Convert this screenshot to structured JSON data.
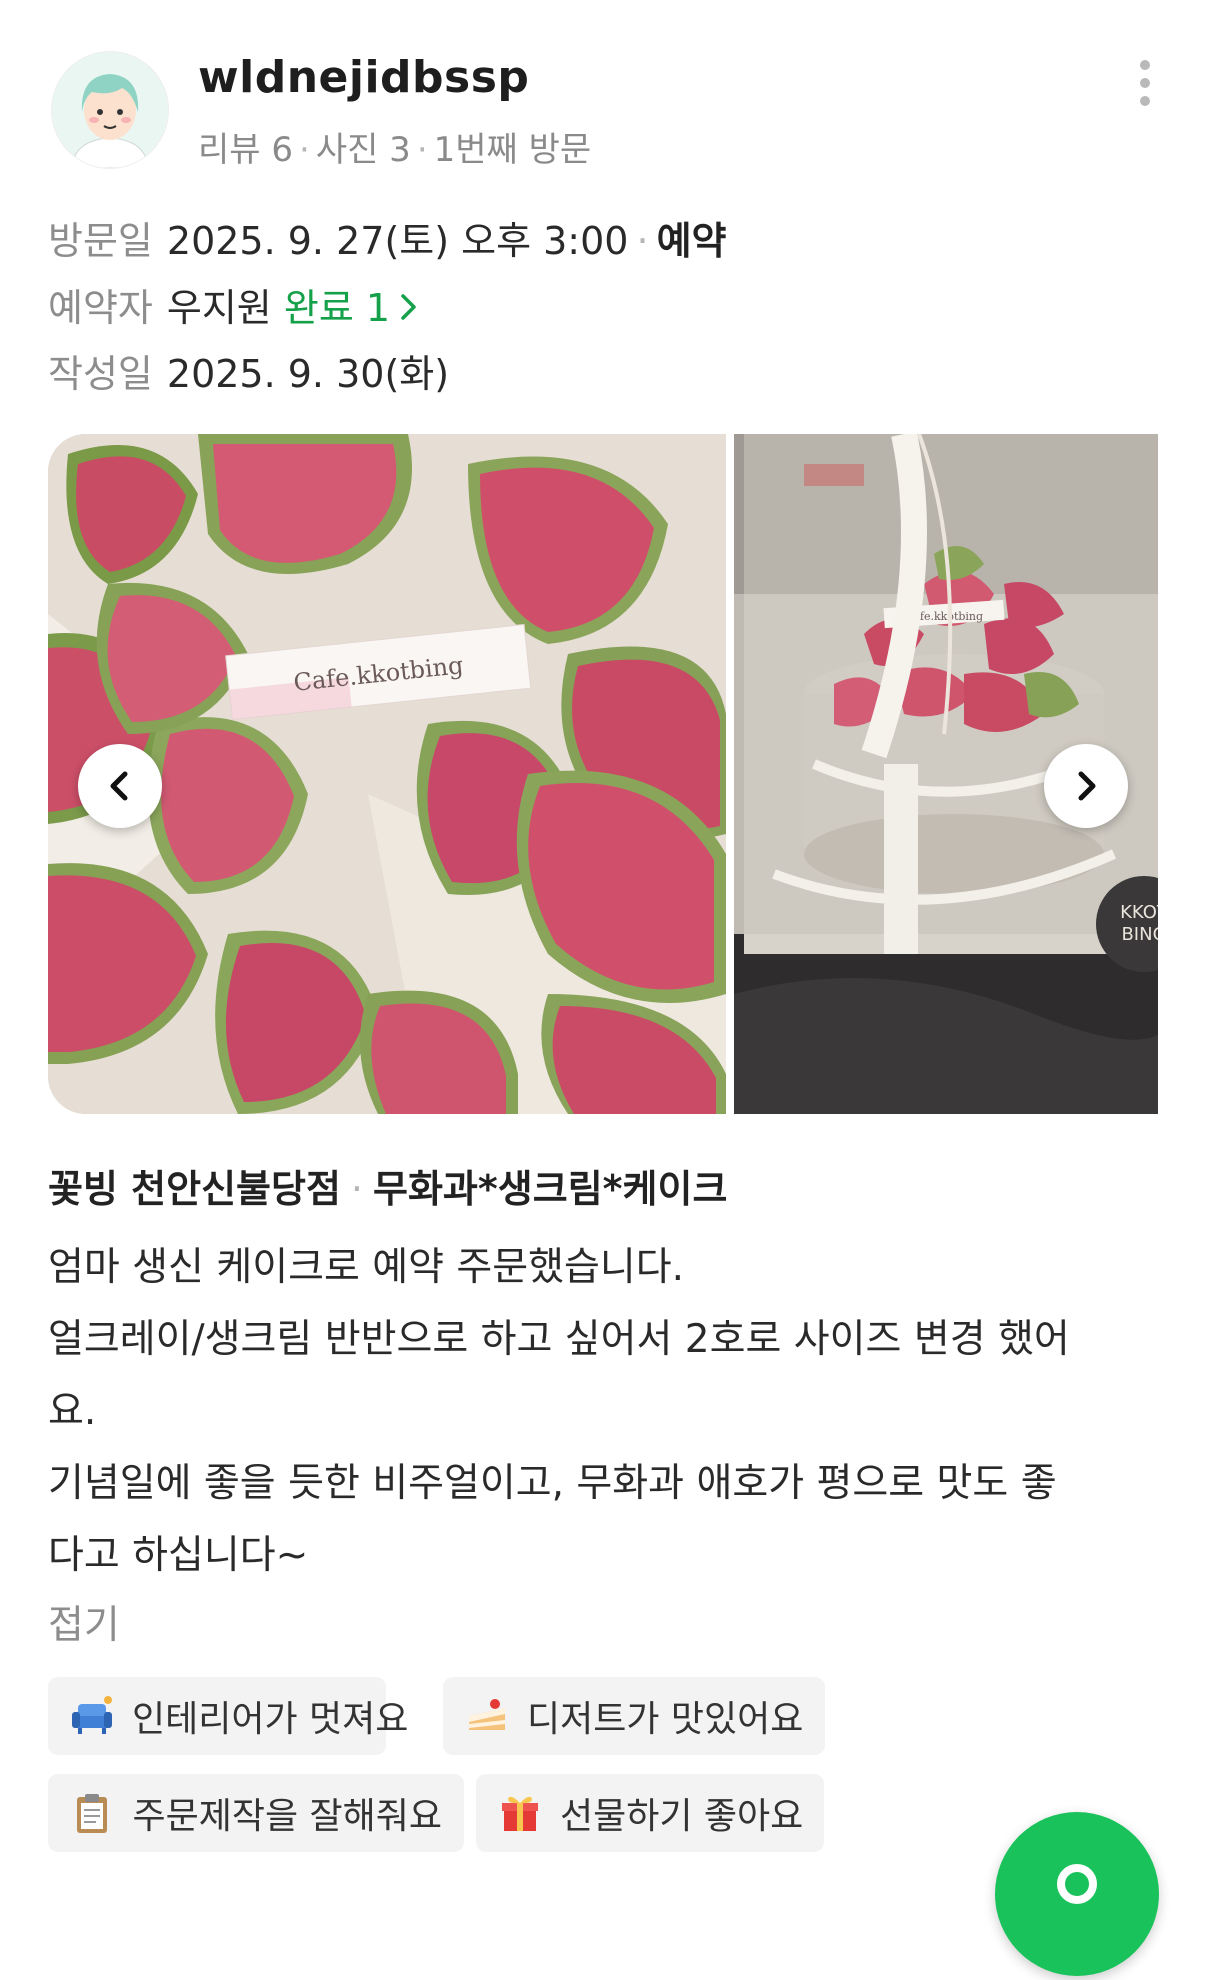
{
  "user": {
    "username": "wldnejidbssp",
    "reviews": "리뷰 6",
    "photos": "사진 3",
    "visit_count": "1번째 방문"
  },
  "visit": {
    "date_label": "방문일",
    "date_value": "2025. 9. 27(토) 오후 3:00",
    "type": "예약",
    "booker_label": "예약자",
    "booker_name": "우지원",
    "booker_status": "완료 1",
    "written_label": "작성일",
    "written_value": "2025. 9. 30(화)"
  },
  "photos": {
    "photo1_caption": "Cafe.kkotbing",
    "photo2_caption": "Cafe.kkotbing",
    "photo2_logo_line1": "KKOT",
    "photo2_logo_line2": "BING"
  },
  "store": {
    "name": "꽃빙 천안신불당점",
    "menu": "무화과*생크림*케이크"
  },
  "review": {
    "lines": [
      "엄마 생신 케이크로 예약 주문했습니다.",
      "얼크레이/생크림 반반으로 하고 싶어서 2호로 사이즈 변경 했어",
      "요.",
      "기념일에 좋을 듯한 비주얼이고, 무화과 애호가 평으로 맛도 좋",
      "다고 하십니다~"
    ],
    "collapse_label": "접기"
  },
  "tags": [
    {
      "label": "인테리어가 멋져요",
      "icon": "sofa-icon"
    },
    {
      "label": "디저트가 맛있어요",
      "icon": "cake-icon"
    },
    {
      "label": "주문제작을 잘해줘요",
      "icon": "clipboard-icon"
    },
    {
      "label": "선물하기 좋아요",
      "icon": "gift-icon"
    }
  ],
  "colors": {
    "accent_green": "#15a04a",
    "fab_green": "#19c25a",
    "muted_gray": "#8d8d8d"
  }
}
